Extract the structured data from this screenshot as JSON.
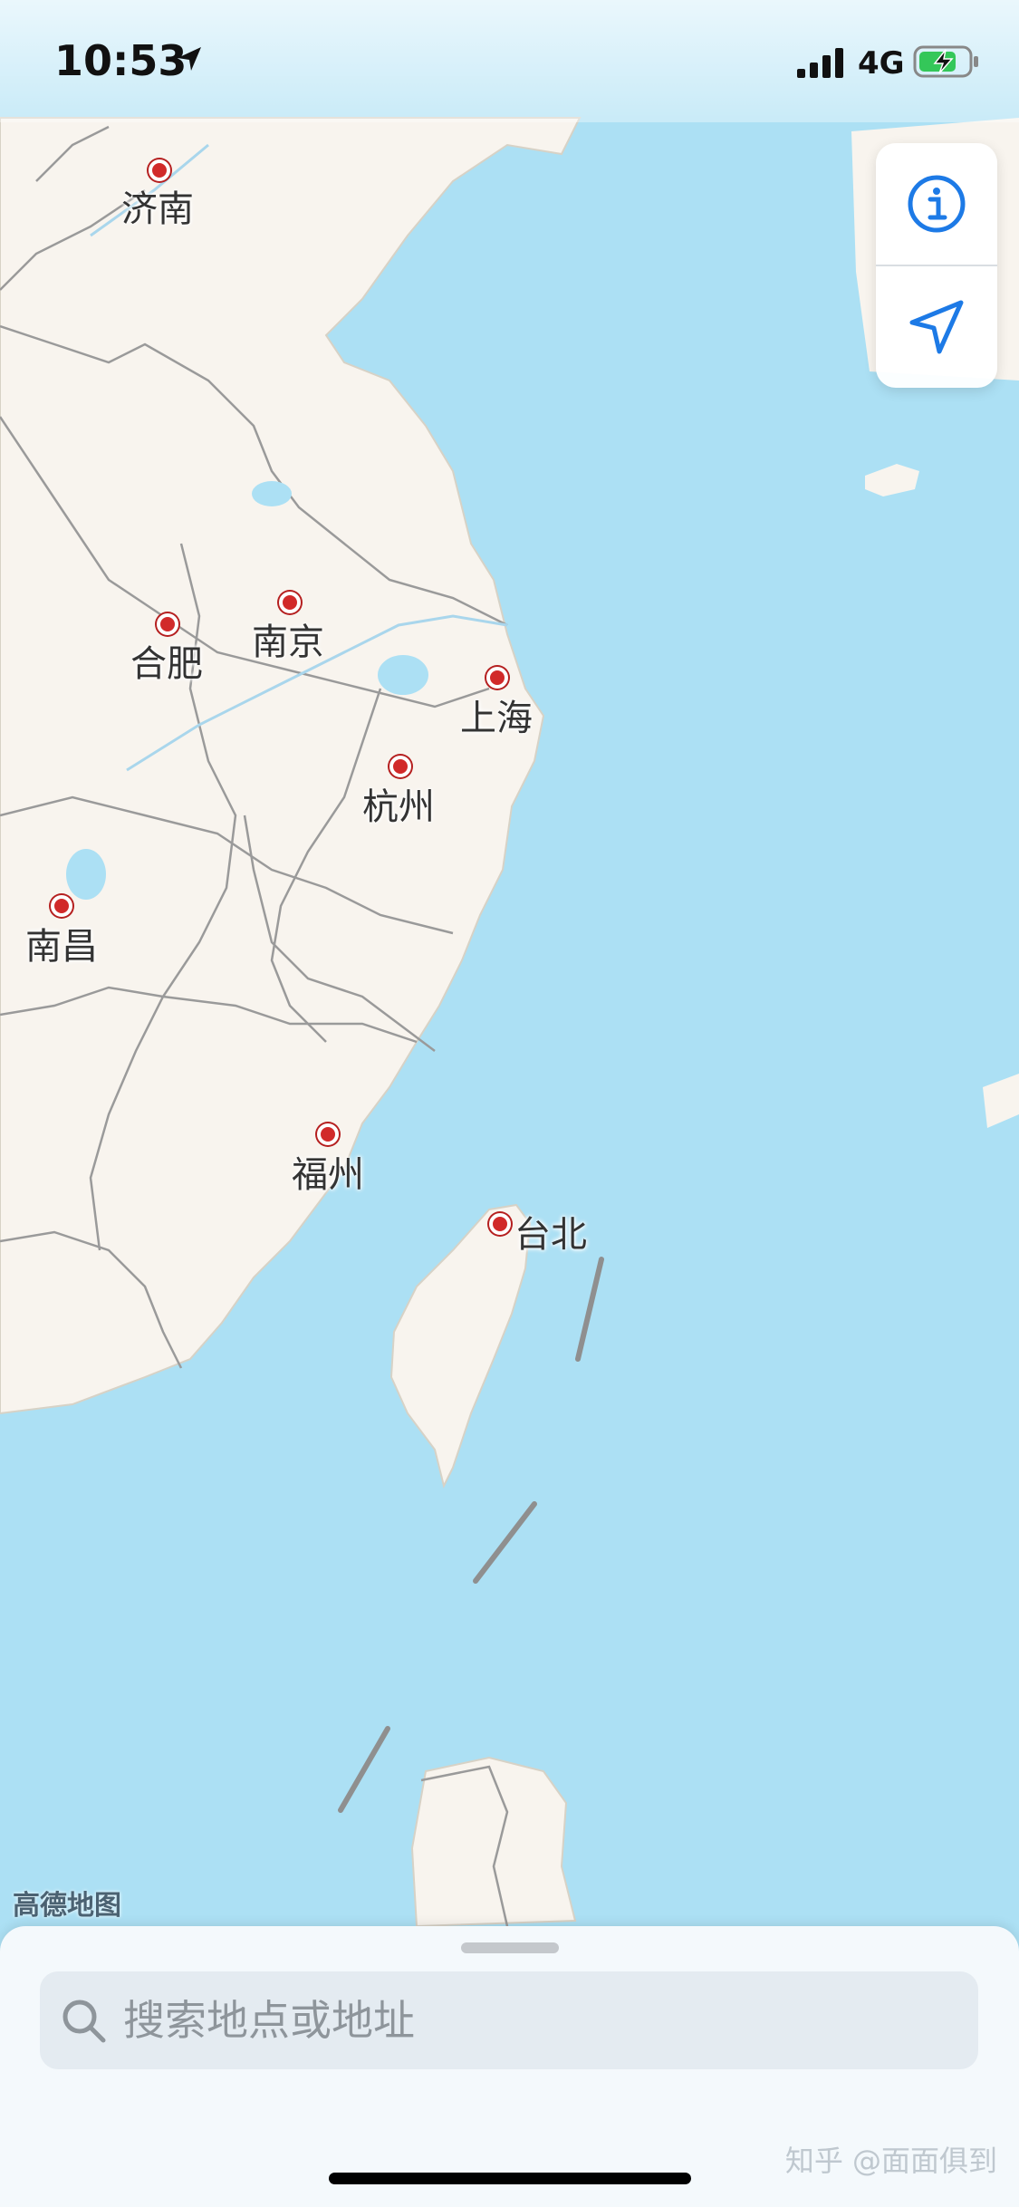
{
  "status_bar": {
    "time": "10:53",
    "network": "4G"
  },
  "map": {
    "attribution": "高德地图",
    "cities": [
      {
        "id": "jinan",
        "name": "济南"
      },
      {
        "id": "hefei",
        "name": "合肥"
      },
      {
        "id": "nanjing",
        "name": "南京"
      },
      {
        "id": "shanghai",
        "name": "上海"
      },
      {
        "id": "hangzhou",
        "name": "杭州"
      },
      {
        "id": "nanchang",
        "name": "南昌"
      },
      {
        "id": "fuzhou",
        "name": "福州"
      },
      {
        "id": "taibei",
        "name": "台北"
      }
    ],
    "colors": {
      "water": "#ace0f4",
      "land": "#f8f4ee",
      "border": "#9a9a9a",
      "city_marker": "#d12a2a",
      "accent": "#1d7ae6"
    }
  },
  "controls": {
    "info_icon": "info-icon",
    "location_icon": "location-arrow-icon"
  },
  "search": {
    "placeholder": "搜索地点或地址"
  },
  "watermark": "知乎 @面面俱到"
}
